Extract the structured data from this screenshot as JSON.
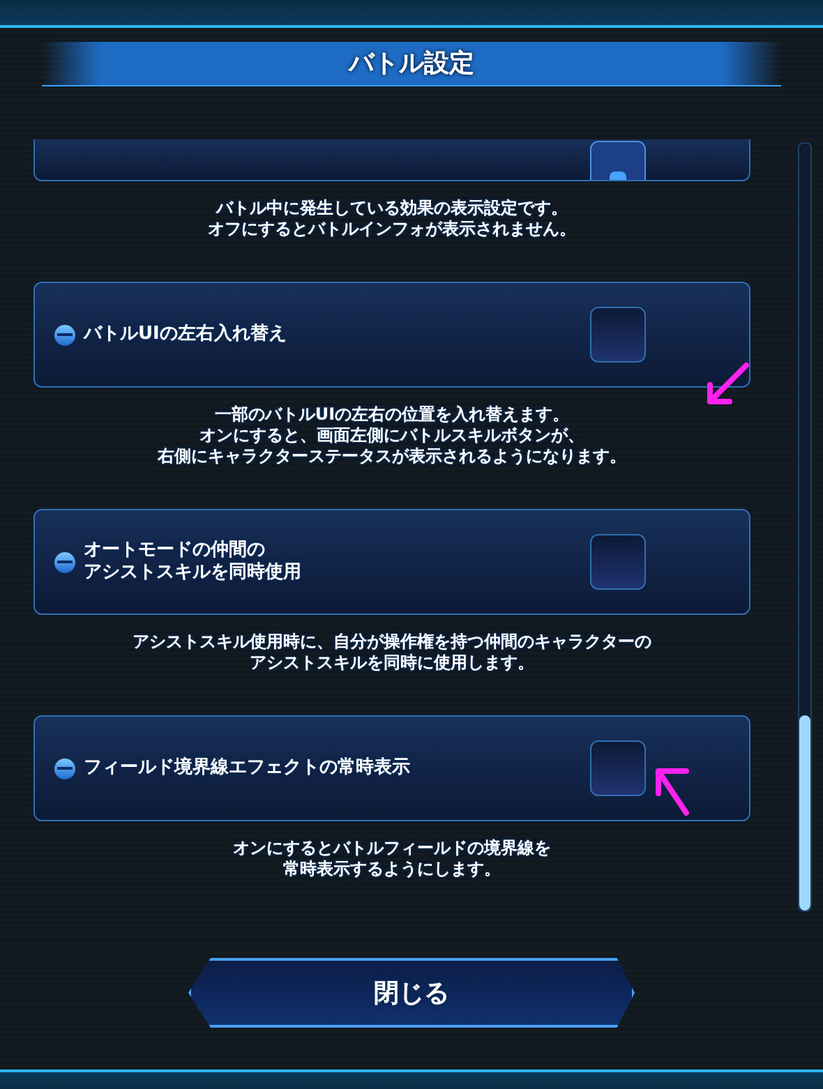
{
  "title": "バトル設定",
  "settings": [
    {
      "checked": true,
      "description_lines": [
        "バトル中に発生している効果の表示設定です。",
        "オフにするとバトルインフォが表示されません。"
      ]
    },
    {
      "label_lines": [
        "バトルUIの左右入れ替え"
      ],
      "checked": false,
      "description_lines": [
        "一部のバトルUIの左右の位置を入れ替えます。",
        "オンにすると、画面左側にバトルスキルボタンが、",
        "右側にキャラクターステータスが表示されるようになります。"
      ]
    },
    {
      "label_lines": [
        "オートモードの仲間の",
        "アシストスキルを同時使用"
      ],
      "checked": false,
      "description_lines": [
        "アシストスキル使用時に、自分が操作権を持つ仲間のキャラクターの",
        "アシストスキルを同時に使用します。"
      ]
    },
    {
      "label_lines": [
        "フィールド境界線エフェクトの常時表示"
      ],
      "checked": false,
      "description_lines": [
        "オンにするとバトルフィールドの境界線を",
        "常時表示するようにします。"
      ]
    }
  ],
  "close_button": "閉じる"
}
